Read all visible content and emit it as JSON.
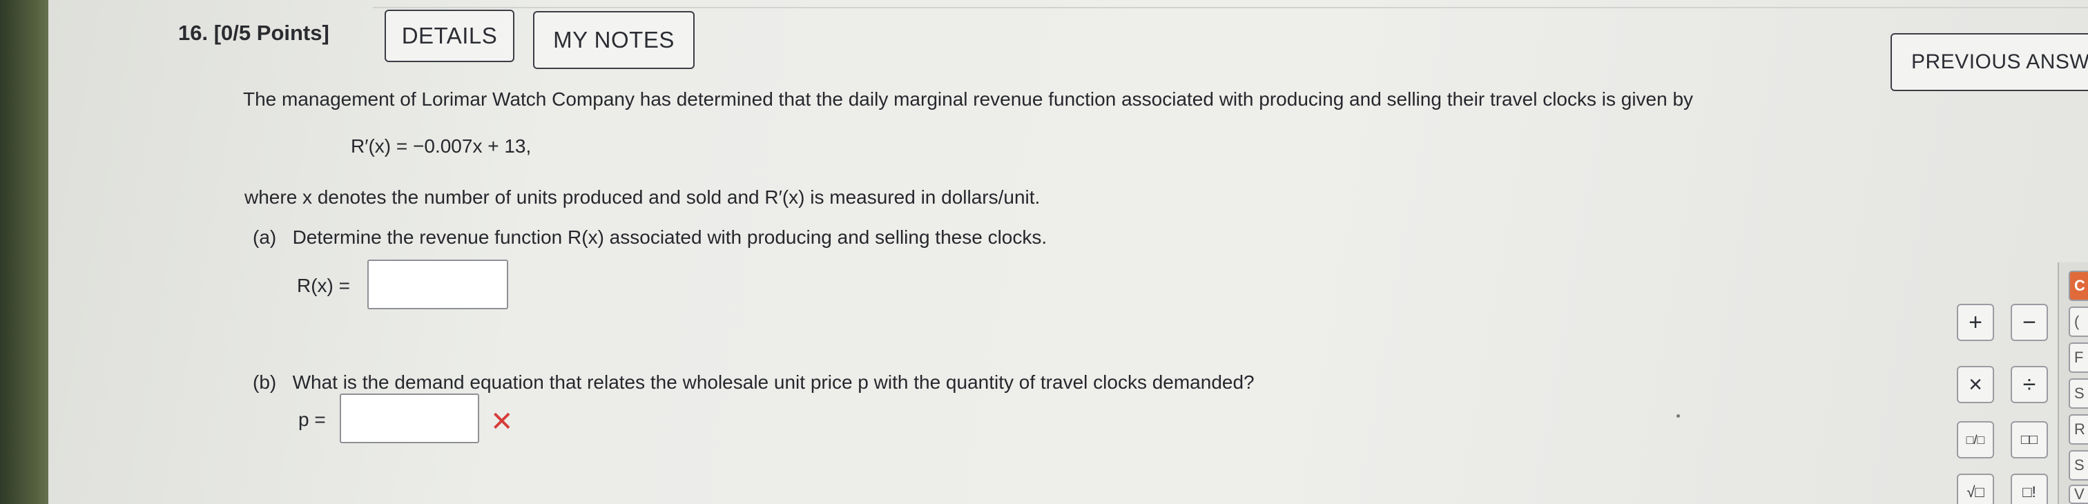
{
  "question": {
    "number_label": "16.",
    "points_label": "[0/5 Points]",
    "details_button": "DETAILS",
    "my_notes_button": "MY NOTES",
    "previous_answers_button": "PREVIOUS ANSW"
  },
  "problem": {
    "intro": "The management of Lorimar Watch Company has determined that the daily marginal revenue function associated with producing and selling their travel clocks is given by",
    "equation": "R′(x) = −0.007x + 13,",
    "where_text": "where x denotes the number of units produced and sold and R′(x) is measured in dollars/unit.",
    "part_a": {
      "label": "(a)",
      "text": "Determine the revenue function R(x) associated with producing and selling these clocks.",
      "answer_label": "R(x) =",
      "answer_value": ""
    },
    "part_b": {
      "label": "(b)",
      "text": "What is the demand equation that relates the wholesale unit price p with the quantity of travel clocks demanded?",
      "answer_label": "p =",
      "answer_value": "",
      "status": "incorrect"
    }
  },
  "calculator": {
    "keys": [
      "+",
      "−",
      "×",
      "÷",
      "□/□",
      "□□",
      "√□",
      "□!"
    ],
    "side_keys": [
      "C",
      "(",
      "F",
      "S",
      "R",
      "S",
      "V"
    ]
  },
  "colors": {
    "incorrect": "#d63c3a",
    "side_accent": "#e06a3a"
  }
}
